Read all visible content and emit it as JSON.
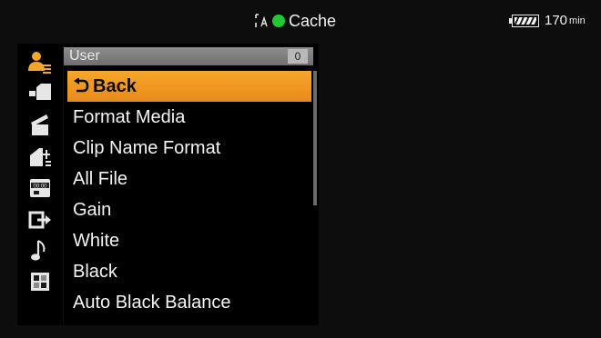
{
  "status_bar": {
    "media_icon": "card-slot-a-icon",
    "status_dot_icon": "status-dot-icon",
    "cache_label": "Cache",
    "battery_icon": "battery-icon",
    "battery_value": "170",
    "battery_unit": "min",
    "colors": {
      "status_dot": "#22c832"
    }
  },
  "sidebar": {
    "icons": [
      {
        "name": "user-menu-icon",
        "active": true
      },
      {
        "name": "camera-menu-icon",
        "active": false
      },
      {
        "name": "clapper-menu-icon",
        "active": false
      },
      {
        "name": "media-menu-icon",
        "active": false
      },
      {
        "name": "timecode-menu-icon",
        "active": false
      },
      {
        "name": "output-menu-icon",
        "active": false
      },
      {
        "name": "audio-menu-icon",
        "active": false
      },
      {
        "name": "system-menu-icon",
        "active": false
      }
    ]
  },
  "menu": {
    "header_title": "User",
    "header_count": "0",
    "back_icon": "back-arrow-icon",
    "items": [
      {
        "label": "Back",
        "selected": true
      },
      {
        "label": "Format Media",
        "selected": false
      },
      {
        "label": "Clip Name Format",
        "selected": false
      },
      {
        "label": "All File",
        "selected": false
      },
      {
        "label": "Gain",
        "selected": false
      },
      {
        "label": "White",
        "selected": false
      },
      {
        "label": "Black",
        "selected": false
      },
      {
        "label": "Auto Black Balance",
        "selected": false
      }
    ],
    "colors": {
      "selected_background": "#f29a22",
      "header_background": "#7e7e7e"
    }
  }
}
